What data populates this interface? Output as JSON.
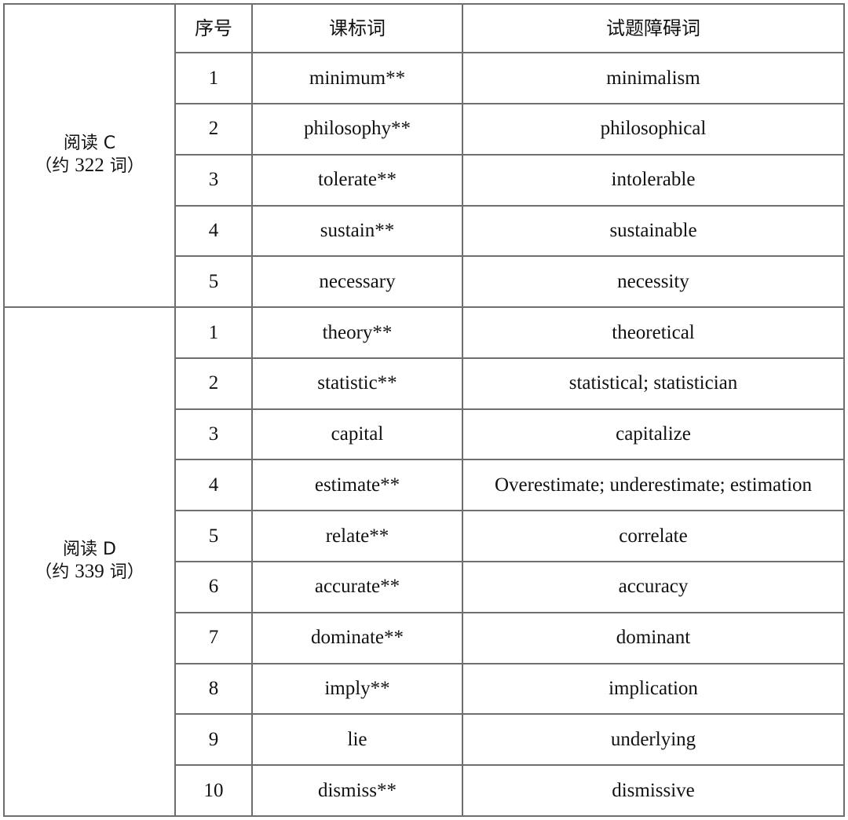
{
  "table": {
    "headers": {
      "section": "",
      "index": "序号",
      "curriculum_word": "课标词",
      "obstacle_word": "试题障碍词"
    },
    "sections": [
      {
        "title": "阅读 C",
        "word_count_prefix": "（约 ",
        "word_count": "322",
        "word_count_suffix": " 词）",
        "rows": [
          {
            "index": "1",
            "curriculum_word": "minimum**",
            "obstacle_word": "minimalism"
          },
          {
            "index": "2",
            "curriculum_word": "philosophy**",
            "obstacle_word": "philosophical"
          },
          {
            "index": "3",
            "curriculum_word": "tolerate**",
            "obstacle_word": "intolerable"
          },
          {
            "index": "4",
            "curriculum_word": "sustain**",
            "obstacle_word": "sustainable"
          },
          {
            "index": "5",
            "curriculum_word": "necessary",
            "obstacle_word": "necessity"
          }
        ]
      },
      {
        "title": "阅读 D",
        "word_count_prefix": "（约 ",
        "word_count": "339",
        "word_count_suffix": " 词）",
        "rows": [
          {
            "index": "1",
            "curriculum_word": "theory**",
            "obstacle_word": "theoretical"
          },
          {
            "index": "2",
            "curriculum_word": "statistic**",
            "obstacle_word": "statistical; statistician"
          },
          {
            "index": "3",
            "curriculum_word": "capital",
            "obstacle_word": "capitalize"
          },
          {
            "index": "4",
            "curriculum_word": "estimate**",
            "obstacle_word": "Overestimate; underestimate; estimation"
          },
          {
            "index": "5",
            "curriculum_word": "relate**",
            "obstacle_word": "correlate"
          },
          {
            "index": "6",
            "curriculum_word": "accurate**",
            "obstacle_word": "accuracy"
          },
          {
            "index": "7",
            "curriculum_word": "dominate**",
            "obstacle_word": "dominant"
          },
          {
            "index": "8",
            "curriculum_word": "imply**",
            "obstacle_word": "implication"
          },
          {
            "index": "9",
            "curriculum_word": "lie",
            "obstacle_word": "underlying"
          },
          {
            "index": "10",
            "curriculum_word": "dismiss**",
            "obstacle_word": "dismissive"
          }
        ]
      }
    ]
  }
}
